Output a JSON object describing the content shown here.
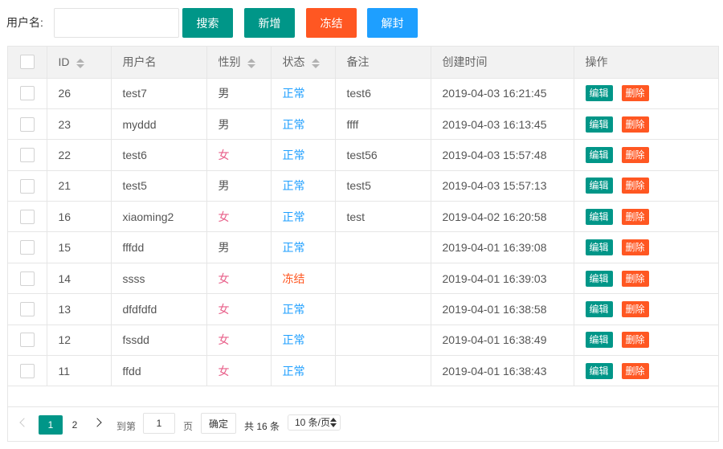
{
  "toolbar": {
    "username_label": "用户名:",
    "username_value": "",
    "search_label": "搜索",
    "add_label": "新增",
    "freeze_label": "冻结",
    "unfreeze_label": "解封"
  },
  "table": {
    "headers": {
      "id": "ID",
      "username": "用户名",
      "gender": "性别",
      "status": "状态",
      "remark": "备注",
      "created": "创建时间",
      "actions": "操作"
    },
    "edit_label": "编辑",
    "delete_label": "删除",
    "rows": [
      {
        "id": "26",
        "username": "test7",
        "gender": "男",
        "status": "正常",
        "remark": "test6",
        "created": "2019-04-03 16:21:45"
      },
      {
        "id": "23",
        "username": "myddd",
        "gender": "男",
        "status": "正常",
        "remark": "ffff",
        "created": "2019-04-03 16:13:45"
      },
      {
        "id": "22",
        "username": "test6",
        "gender": "女",
        "status": "正常",
        "remark": "test56",
        "created": "2019-04-03 15:57:48"
      },
      {
        "id": "21",
        "username": "test5",
        "gender": "男",
        "status": "正常",
        "remark": "test5",
        "created": "2019-04-03 15:57:13"
      },
      {
        "id": "16",
        "username": "xiaoming2",
        "gender": "女",
        "status": "正常",
        "remark": "test",
        "created": "2019-04-02 16:20:58"
      },
      {
        "id": "15",
        "username": "fffdd",
        "gender": "男",
        "status": "正常",
        "remark": "",
        "created": "2019-04-01 16:39:08"
      },
      {
        "id": "14",
        "username": "ssss",
        "gender": "女",
        "status": "冻结",
        "remark": "",
        "created": "2019-04-01 16:39:03"
      },
      {
        "id": "13",
        "username": "dfdfdfd",
        "gender": "女",
        "status": "正常",
        "remark": "",
        "created": "2019-04-01 16:38:58"
      },
      {
        "id": "12",
        "username": "fssdd",
        "gender": "女",
        "status": "正常",
        "remark": "",
        "created": "2019-04-01 16:38:49"
      },
      {
        "id": "11",
        "username": "ffdd",
        "gender": "女",
        "status": "正常",
        "remark": "",
        "created": "2019-04-01 16:38:43"
      }
    ]
  },
  "pagination": {
    "current_page": "1",
    "page_2": "2",
    "goto_label": "到第",
    "goto_value": "1",
    "page_label": "页",
    "confirm_label": "确定",
    "total_label": "共 16 条",
    "page_size_label": "10 条/页"
  },
  "colors": {
    "primary": "#009688",
    "danger": "#FF5722",
    "info": "#1E9FFF",
    "female": "#e8608a"
  }
}
